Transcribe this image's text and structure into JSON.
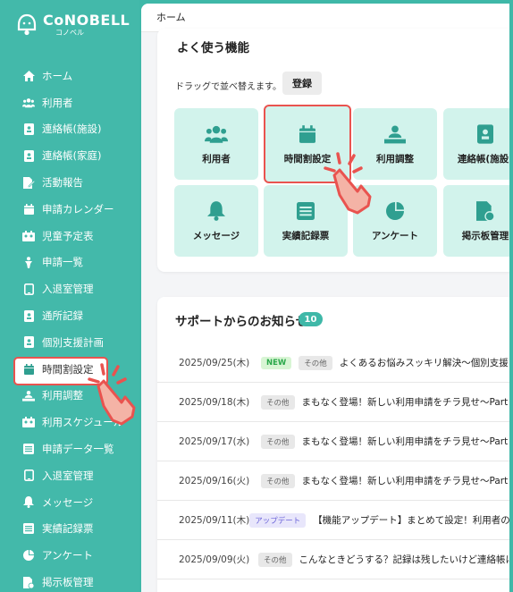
{
  "brand": {
    "title": "CoNOBELL",
    "sub": "コノベル"
  },
  "colors": {
    "brand": "#43b9aa",
    "highlight": "#e9534f",
    "tile": "#d2f3ec"
  },
  "sidebar": {
    "items": [
      {
        "label": "ホーム",
        "icon": "home-icon"
      },
      {
        "label": "利用者",
        "icon": "users-icon"
      },
      {
        "label": "連絡帳(施設)",
        "icon": "contact-book-icon"
      },
      {
        "label": "連絡帳(家庭)",
        "icon": "contact-book-icon"
      },
      {
        "label": "活動報告",
        "icon": "edit-note-icon"
      },
      {
        "label": "申請カレンダー",
        "icon": "calendar-icon"
      },
      {
        "label": "児童予定表",
        "icon": "schedule-icon"
      },
      {
        "label": "申請一覧",
        "icon": "person-icon"
      },
      {
        "label": "入退室管理",
        "icon": "tablet-icon"
      },
      {
        "label": "通所記録",
        "icon": "contact-book-icon"
      },
      {
        "label": "個別支援計画",
        "icon": "contact-book-icon"
      },
      {
        "label": "時間割設定",
        "icon": "calendar-icon"
      },
      {
        "label": "利用調整",
        "icon": "group-adjust-icon"
      },
      {
        "label": "利用スケジュール",
        "icon": "schedule-icon"
      },
      {
        "label": "申請データ一覧",
        "icon": "list-icon"
      },
      {
        "label": "入退室管理",
        "icon": "tablet-icon"
      },
      {
        "label": "メッセージ",
        "icon": "bell-icon"
      },
      {
        "label": "実績記録票",
        "icon": "list-icon"
      },
      {
        "label": "アンケート",
        "icon": "pie-chart-icon"
      },
      {
        "label": "掲示板管理",
        "icon": "document-check-icon"
      }
    ]
  },
  "topbar": {
    "breadcrumb": "ホーム"
  },
  "favorites": {
    "title": "よく使う機能",
    "hint": "ドラッグで並べ替えます。",
    "register": "登録",
    "tiles": [
      {
        "label": "利用者",
        "icon": "users-icon"
      },
      {
        "label": "時間割設定",
        "icon": "calendar-icon"
      },
      {
        "label": "利用調整",
        "icon": "group-adjust-icon"
      },
      {
        "label": "連絡帳(施設)",
        "icon": "contact-book-icon"
      },
      {
        "label": "メッセージ",
        "icon": "bell-icon"
      },
      {
        "label": "実績記録票",
        "icon": "list-icon"
      },
      {
        "label": "アンケート",
        "icon": "pie-chart-icon"
      },
      {
        "label": "掲示板管理",
        "icon": "document-check-icon"
      }
    ]
  },
  "news": {
    "title": "サポートからのお知らせ",
    "count": "10",
    "rows": [
      {
        "date": "2025/09/25(木)",
        "badge": "NEW",
        "badge2": "その他",
        "text": "よくあるお悩みスッキリ解決～個別支援"
      },
      {
        "date": "2025/09/18(木)",
        "badge": "その他",
        "text": "まもなく登場！新しい利用申請をチラ見せ～Part"
      },
      {
        "date": "2025/09/17(水)",
        "badge": "その他",
        "text": "まもなく登場！新しい利用申請をチラ見せ～Part"
      },
      {
        "date": "2025/09/16(火)",
        "badge": "その他",
        "text": "まもなく登場！新しい利用申請をチラ見せ～Part"
      },
      {
        "date": "2025/09/11(木)",
        "badge": "アップデート",
        "text": "【機能アップデート】まとめて設定！利用者のグル"
      },
      {
        "date": "2025/09/09(火)",
        "badge": "その他",
        "text": "こんなときどうする？記録は残したいけど連絡帳に"
      }
    ]
  }
}
